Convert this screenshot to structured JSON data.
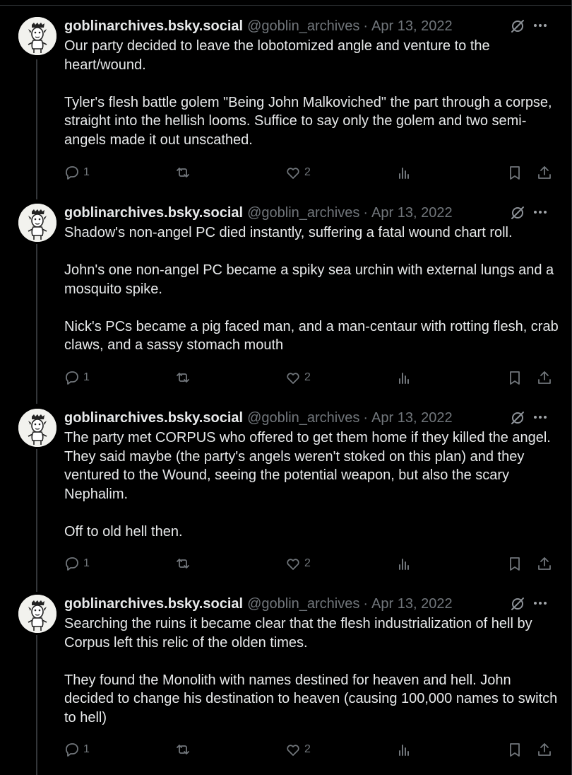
{
  "colors": {
    "background": "#000000",
    "text": "#e7e9ea",
    "muted": "#71767b",
    "divider": "#2f3336"
  },
  "posts": [
    {
      "display_name": "goblinarchives.bsky.social",
      "handle": "@goblin_archives",
      "date": "Apr 13, 2022",
      "text": "Our party decided to leave the lobotomized angle and venture to the heart/wound.\n\nTyler's flesh battle golem \"Being John Malkoviched\" the part through a corpse, straight into the hellish looms. Suffice to say only the golem and two semi-angels made it out unscathed.",
      "replies": "1",
      "likes": "2"
    },
    {
      "display_name": "goblinarchives.bsky.social",
      "handle": "@goblin_archives",
      "date": "Apr 13, 2022",
      "text": "Shadow's non-angel PC died instantly, suffering a fatal wound chart roll.\n\nJohn's one non-angel PC became a spiky sea urchin with external lungs and a mosquito spike.\n\nNick's PCs became a pig faced man, and a man-centaur with rotting flesh, crab claws, and a sassy stomach mouth",
      "replies": "1",
      "likes": "2"
    },
    {
      "display_name": "goblinarchives.bsky.social",
      "handle": "@goblin_archives",
      "date": "Apr 13, 2022",
      "text": "The party met CORPUS who offered to get them home if they killed the angel. They said maybe (the party's angels weren't stoked on this plan) and they ventured to the Wound, seeing the potential weapon, but also the scary Nephalim.\n\nOff to old hell then.",
      "replies": "1",
      "likes": "2"
    },
    {
      "display_name": "goblinarchives.bsky.social",
      "handle": "@goblin_archives",
      "date": "Apr 13, 2022",
      "text": "Searching the ruins it became clear that the flesh industrialization of hell by Corpus left this relic of the olden times.\n\nThey found the Monolith with names destined for heaven and hell. John decided to change his destination to heaven (causing 100,000 names to switch to hell)",
      "replies": "1",
      "likes": "2"
    }
  ],
  "icons": {
    "reply": "reply-icon",
    "repost": "repost-icon",
    "like": "heart-icon",
    "views": "views-icon",
    "bookmark": "bookmark-icon",
    "share": "share-icon",
    "grok": "grok-icon",
    "more": "more-icon"
  }
}
